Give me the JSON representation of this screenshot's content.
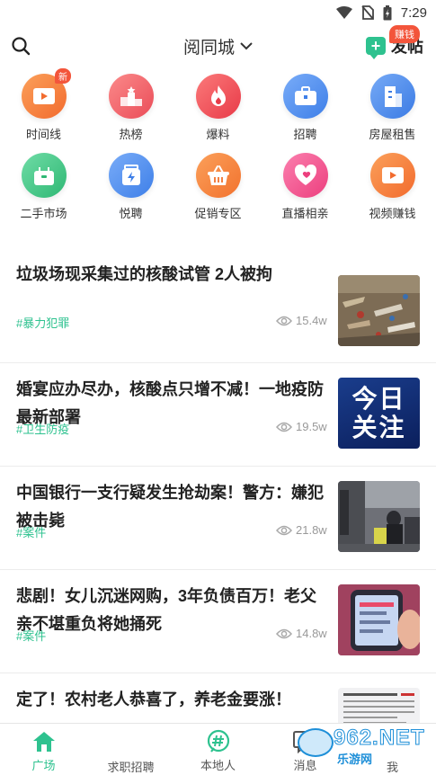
{
  "status_bar": {
    "time": "7:29"
  },
  "header": {
    "city": "阅同城",
    "post_label": "发帖",
    "earn_badge": "赚钱"
  },
  "grid": [
    {
      "label": "时间线",
      "icon": "video-icon",
      "color": "#f6873f",
      "badge": "新"
    },
    {
      "label": "热榜",
      "icon": "podium-icon",
      "color": "#f2616b"
    },
    {
      "label": "爆料",
      "icon": "fire-icon",
      "color": "#f2545b"
    },
    {
      "label": "招聘",
      "icon": "briefcase-icon",
      "color": "#4c8ef2"
    },
    {
      "label": "房屋租售",
      "icon": "building-icon",
      "color": "#4a90ee"
    },
    {
      "label": "二手市场",
      "icon": "box-icon",
      "color": "#3fc787"
    },
    {
      "label": "悦聘",
      "icon": "lightning-box-icon",
      "color": "#4c8ef2"
    },
    {
      "label": "促销专区",
      "icon": "basket-icon",
      "color": "#f68a3c"
    },
    {
      "label": "直播相亲",
      "icon": "heart-icon",
      "color": "#f5508a"
    },
    {
      "label": "视频赚钱",
      "icon": "video-icon",
      "color": "#f6873f"
    }
  ],
  "news": [
    {
      "title": "垃圾场现采集过的核酸试管 2人被拘",
      "tag": "#暴力犯罪",
      "views": "15.4w",
      "thumb": "garbage-photo"
    },
    {
      "title": "婚宴应办尽办，核酸点只增不减！一地疫防最新部署",
      "tag": "#卫生防疫",
      "views": "19.5w",
      "thumb": "today-focus-graphic",
      "thumb_text": [
        "今日",
        "关注"
      ]
    },
    {
      "title": "中国银行一支行疑发生抢劫案！警方：嫌犯被击毙",
      "tag": "#案件",
      "views": "21.8w",
      "thumb": "street-photo"
    },
    {
      "title": "悲剧！女儿沉迷网购，3年负债百万！老父亲不堪重负将她捅死",
      "tag": "#案件",
      "views": "14.8w",
      "thumb": "phone-photo"
    },
    {
      "title": "定了！农村老人恭喜了，养老金要涨！",
      "thumb": "document-photo"
    }
  ],
  "bottom_nav": [
    {
      "label": "广场",
      "icon": "home-icon",
      "active": true
    },
    {
      "label": "求职招聘",
      "icon": "",
      "active": false
    },
    {
      "label": "本地人",
      "icon": "hashtag-icon",
      "active": false
    },
    {
      "label": "消息",
      "icon": "message-icon",
      "active": false
    },
    {
      "label": "我",
      "icon": "",
      "active": false
    }
  ],
  "watermark": {
    "text": "962.NET",
    "sub": "乐游网"
  },
  "colors": {
    "accent": "#2ec28f",
    "badge": "#f3553b"
  }
}
